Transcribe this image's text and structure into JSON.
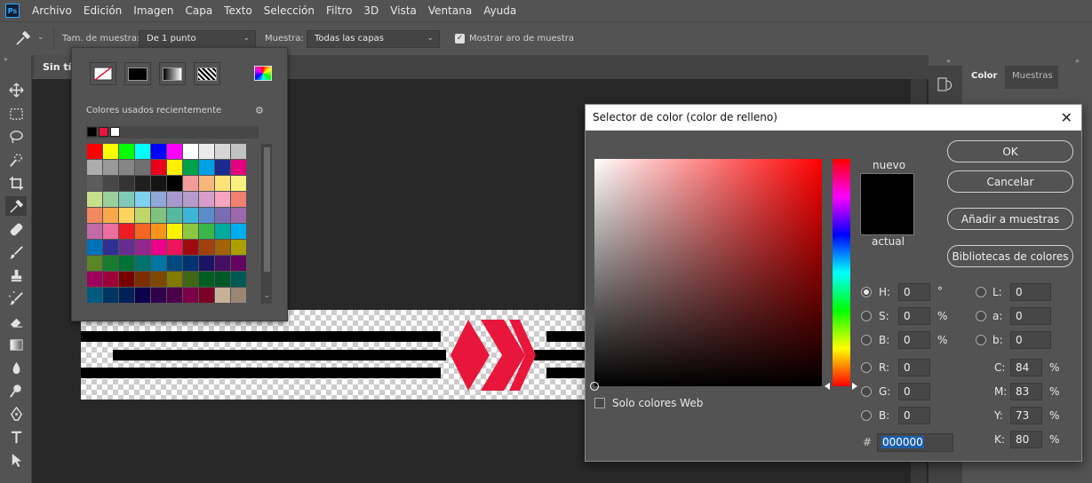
{
  "menubar": {
    "logo": "Ps",
    "items": [
      "Archivo",
      "Edición",
      "Imagen",
      "Capa",
      "Texto",
      "Selección",
      "Filtro",
      "3D",
      "Vista",
      "Ventana",
      "Ayuda"
    ]
  },
  "options": {
    "sample_size_label": "Tam. de muestra:",
    "sample_size_value": "De 1 punto",
    "sample_label": "Muestra:",
    "sample_value": "Todas las capas",
    "show_ring_label": "Mostrar aro de muestra",
    "show_ring_checked": true
  },
  "document": {
    "tab_title": "Sin títu"
  },
  "swatches_popup": {
    "recent_label": "Colores usados recientemente",
    "recent": [
      "#000000",
      "#e8163a",
      "#ffffff"
    ],
    "grid": [
      "#ff0000",
      "#ffff00",
      "#00ff00",
      "#00ffff",
      "#0000ff",
      "#ff00ff",
      "#ffffff",
      "#ebebeb",
      "#d6d6d6",
      "#c2c2c2",
      "#adadad",
      "#999999",
      "#858585",
      "#707070",
      "#e8001c",
      "#fff000",
      "#00a14b",
      "#00a0e4",
      "#1b2a8f",
      "#e5007e",
      "#5c5c5c",
      "#474747",
      "#333333",
      "#1f1f1f",
      "#141414",
      "#000000",
      "#f29c9c",
      "#f7b77c",
      "#fde27c",
      "#f8f07e",
      "#c8e08c",
      "#9ad09b",
      "#7fcbb8",
      "#7fd1ee",
      "#8fa8d8",
      "#a899cc",
      "#b49ccb",
      "#d89dc8",
      "#f5a5c0",
      "#f08070",
      "#f38760",
      "#f9a94c",
      "#fdd45b",
      "#bfd66a",
      "#82c27f",
      "#57b8a0",
      "#3fb5d6",
      "#5a8ccb",
      "#7a6db6",
      "#9c6aac",
      "#c06aa8",
      "#ec6f9f",
      "#ed1c24",
      "#f26522",
      "#f7941d",
      "#fff200",
      "#8dc63f",
      "#39b54a",
      "#00a99d",
      "#00aeef",
      "#0072bc",
      "#2e3192",
      "#662d91",
      "#92278f",
      "#ec008c",
      "#ed145b",
      "#9e0b0f",
      "#a0410d",
      "#a36209",
      "#aba000",
      "#598527",
      "#197b30",
      "#007236",
      "#00746b",
      "#0076a3",
      "#004a80",
      "#003471",
      "#1b1464",
      "#440e62",
      "#630460",
      "#9e005d",
      "#9e0039",
      "#790000",
      "#7b2e00",
      "#7d4900",
      "#827b00",
      "#406618",
      "#005e20",
      "#005826",
      "#005952",
      "#005b7f",
      "#003663",
      "#002157",
      "#0d004c",
      "#32004b",
      "#4b0049",
      "#7b0046",
      "#7a0026",
      "#c7b299",
      "#998675"
    ]
  },
  "panel": {
    "tab_color": "Color",
    "tab_swatches": "Muestras"
  },
  "picker": {
    "title": "Selector de color (color de relleno)",
    "label_new": "nuevo",
    "label_current": "actual",
    "ok": "OK",
    "cancel": "Cancelar",
    "add_to_swatches": "Añadir a muestras",
    "color_libraries": "Bibliotecas de colores",
    "web_only_label": "Solo colores Web",
    "hsb": {
      "h": "0",
      "s": "0",
      "b": "0",
      "h_unit": "°",
      "s_unit": "%",
      "b_unit": "%"
    },
    "rgb": {
      "r": "0",
      "g": "0",
      "b": "0"
    },
    "lab": {
      "l": "0",
      "a": "0",
      "b": "0"
    },
    "cmyk": {
      "c": "84",
      "m": "83",
      "y": "73",
      "k": "80",
      "unit": "%"
    },
    "hex_label": "#",
    "hex": "000000",
    "accent_hue_color": "#ff0000"
  }
}
